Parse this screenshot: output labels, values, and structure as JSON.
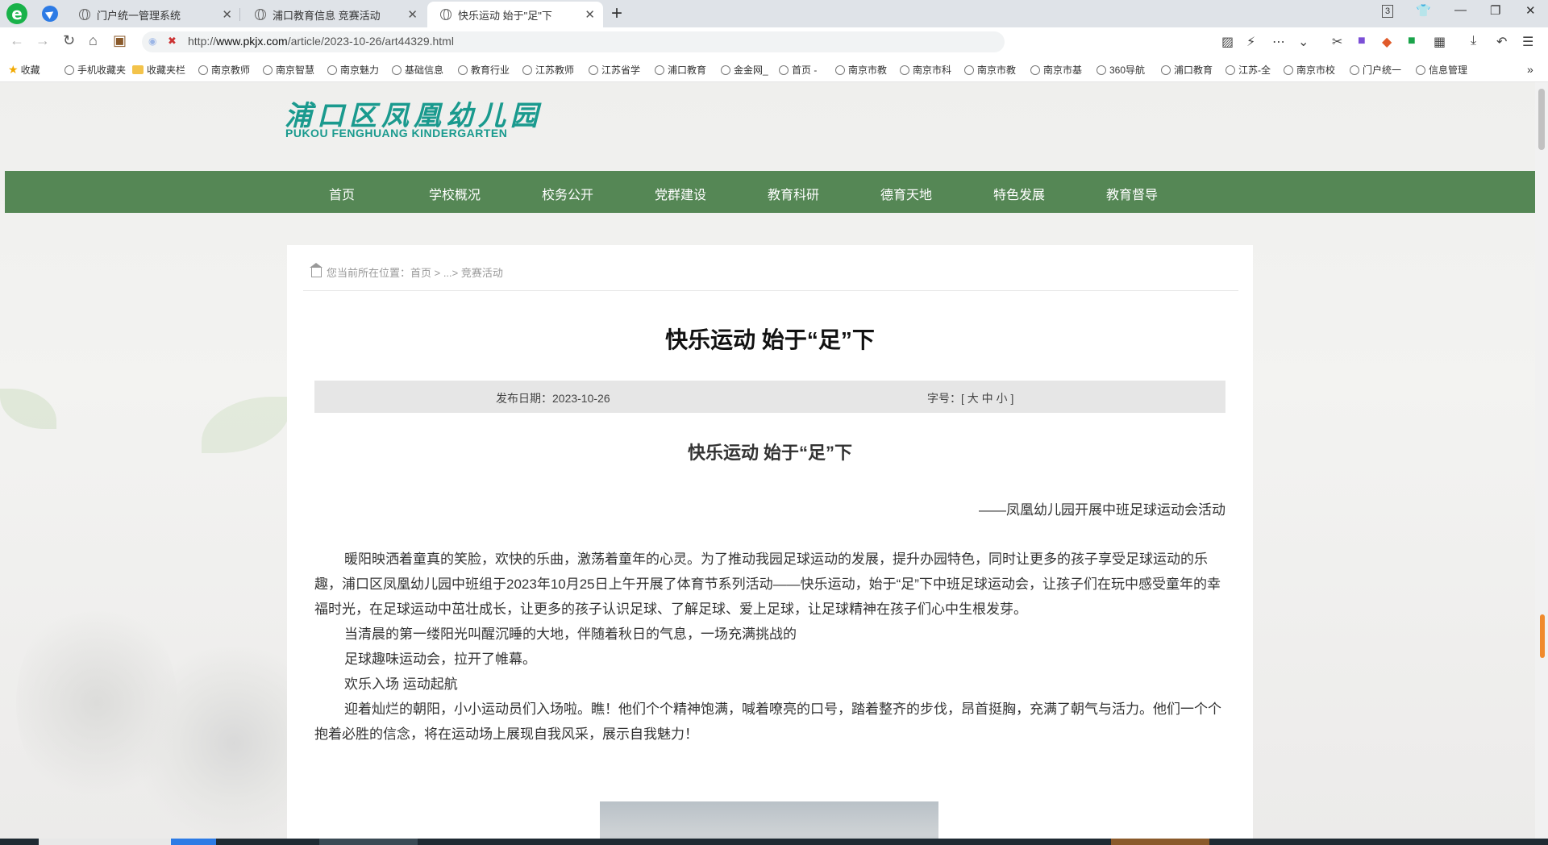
{
  "browser": {
    "tabs": [
      {
        "title": "门户统一管理系统",
        "active": false
      },
      {
        "title": "浦口教育信息 竞赛活动",
        "active": false
      },
      {
        "title": "快乐运动 始于\"足\"下",
        "active": true
      }
    ],
    "url_prefix": "http://",
    "url_host": "www.pkjx.com",
    "url_path": "/article/2023-10-26/art44329.html",
    "tab_count_badge": "3",
    "new_tab_symbol": "+",
    "bookmarks": [
      {
        "label": "收藏",
        "icon": "star-icon"
      },
      {
        "label": "手机收藏夹",
        "icon": "phone-icon"
      },
      {
        "label": "收藏夹栏",
        "icon": "folder-icon"
      },
      {
        "label": "南京教师",
        "icon": "site-icon"
      },
      {
        "label": "南京智慧",
        "icon": "site-icon"
      },
      {
        "label": "南京魅力",
        "icon": "globe-icon"
      },
      {
        "label": "基础信息",
        "icon": "pib-icon"
      },
      {
        "label": "教育行业",
        "icon": "globe-icon"
      },
      {
        "label": "江苏教师",
        "icon": "site-icon"
      },
      {
        "label": "江苏省学",
        "icon": "globe-icon"
      },
      {
        "label": "浦口教育",
        "icon": "globe-icon"
      },
      {
        "label": "金金网_",
        "icon": "globe-icon"
      },
      {
        "label": "首页 -",
        "icon": "globe-icon"
      },
      {
        "label": "南京市教",
        "icon": "globe-icon"
      },
      {
        "label": "南京市科",
        "icon": "globe-icon"
      },
      {
        "label": "南京市教",
        "icon": "globe-icon"
      },
      {
        "label": "南京市基",
        "icon": "globe-icon"
      },
      {
        "label": "360导航",
        "icon": "site-icon"
      },
      {
        "label": "浦口教育",
        "icon": "globe-icon"
      },
      {
        "label": "江苏-全",
        "icon": "site-icon"
      },
      {
        "label": "南京市校",
        "icon": "site-icon"
      },
      {
        "label": "门户统一",
        "icon": "globe-icon"
      },
      {
        "label": "信息管理",
        "icon": "globe-icon"
      }
    ],
    "bookmarks_overflow": "»"
  },
  "site": {
    "logo_cn": "浦口区凤凰幼儿园",
    "logo_en": "PUKOU FENGHUANG KINDERGARTEN",
    "nav": [
      "首页",
      "学校概况",
      "校务公开",
      "党群建设",
      "教育科研",
      "德育天地",
      "特色发展",
      "教育督导"
    ],
    "brand_green": "#558755"
  },
  "article": {
    "breadcrumb": "您当前所在位置：首页 > ...> 竞赛活动",
    "title": "快乐运动 始于“足”下",
    "publish_date": "发布日期：2023-10-26",
    "font_size_ctrl": "字号：[ 大 中 小 ]",
    "subtitle": "快乐运动  始于“足”下",
    "byline": "——凤凰幼儿园开展中班足球运动会活动",
    "paragraphs": [
      "暖阳映洒着童真的笑脸，欢快的乐曲，激荡着童年的心灵。为了推动我园足球运动的发展，提升办园特色，同时让更多的孩子享受足球运动的乐趣，浦口区凤凰幼儿园中班组于2023年10月25日上午开展了体育节系列活动——快乐运动，始于“足”下中班足球运动会，让孩子们在玩中感受童年的幸福时光，在足球运动中茁壮成长，让更多的孩子认识足球、了解足球、爱上足球，让足球精神在孩子们心中生根发芽。",
      "当清晨的第一缕阳光叫醒沉睡的大地，伴随着秋日的气息，一场充满挑战的",
      "足球趣味运动会，拉开了帷幕。",
      "欢乐入场 运动起航",
      " 迎着灿烂的朝阳，小小运动员们入场啦。瞧！他们个个精神饱满，喊着嘹亮的口号，踏着整齐的步伐，昂首挺胸，充满了朝气与活力。他们一个个抱着必胜的信念，将在运动场上展现自我风采，展示自我魅力！"
    ]
  }
}
